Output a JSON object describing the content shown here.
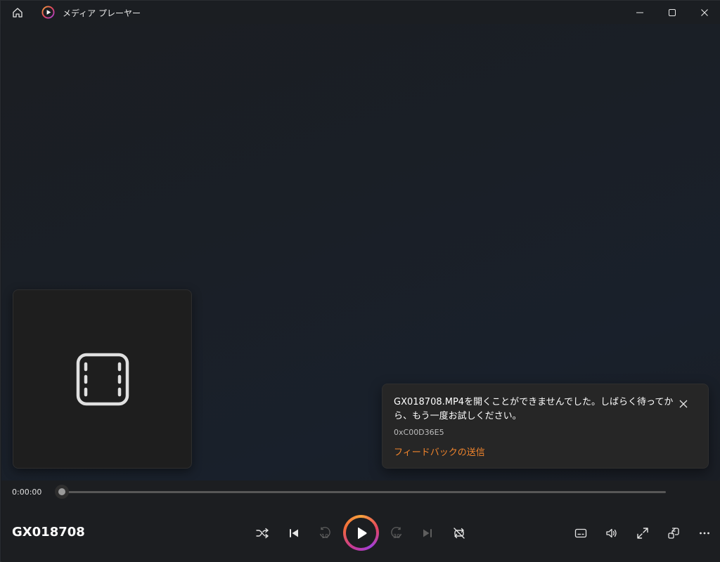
{
  "window": {
    "title": "メディア プレーヤー"
  },
  "toast": {
    "message": "GX018708.MP4を開くことができませんでした。しばらく待ってから、もう一度お試しください。",
    "error_code": "0xC00D36E5",
    "feedback_link": "フィードバックの送信"
  },
  "player": {
    "current_time": "0:00:00",
    "progress": 0,
    "media_title": "GX018708",
    "skip_back_seconds": "10",
    "skip_forward_seconds": "30"
  },
  "icons": {
    "home": "home-icon",
    "app": "media-player-icon",
    "minimize": "minimize-icon",
    "maximize": "maximize-icon",
    "close": "close-icon",
    "film": "film-icon",
    "shuffle": "shuffle-icon",
    "previous": "previous-icon",
    "skip_back": "skip-back-10-icon",
    "play": "play-icon",
    "skip_forward": "skip-forward-30-icon",
    "next": "next-icon",
    "repeat": "repeat-off-icon",
    "subtitles": "subtitles-icon",
    "volume": "volume-icon",
    "fullscreen": "fullscreen-icon",
    "miniplayer": "miniplayer-icon",
    "more": "more-icon"
  },
  "colors": {
    "accent": "#f0842c",
    "play_ring_start": "#f7a33c",
    "play_ring_end": "#a13fd8"
  }
}
